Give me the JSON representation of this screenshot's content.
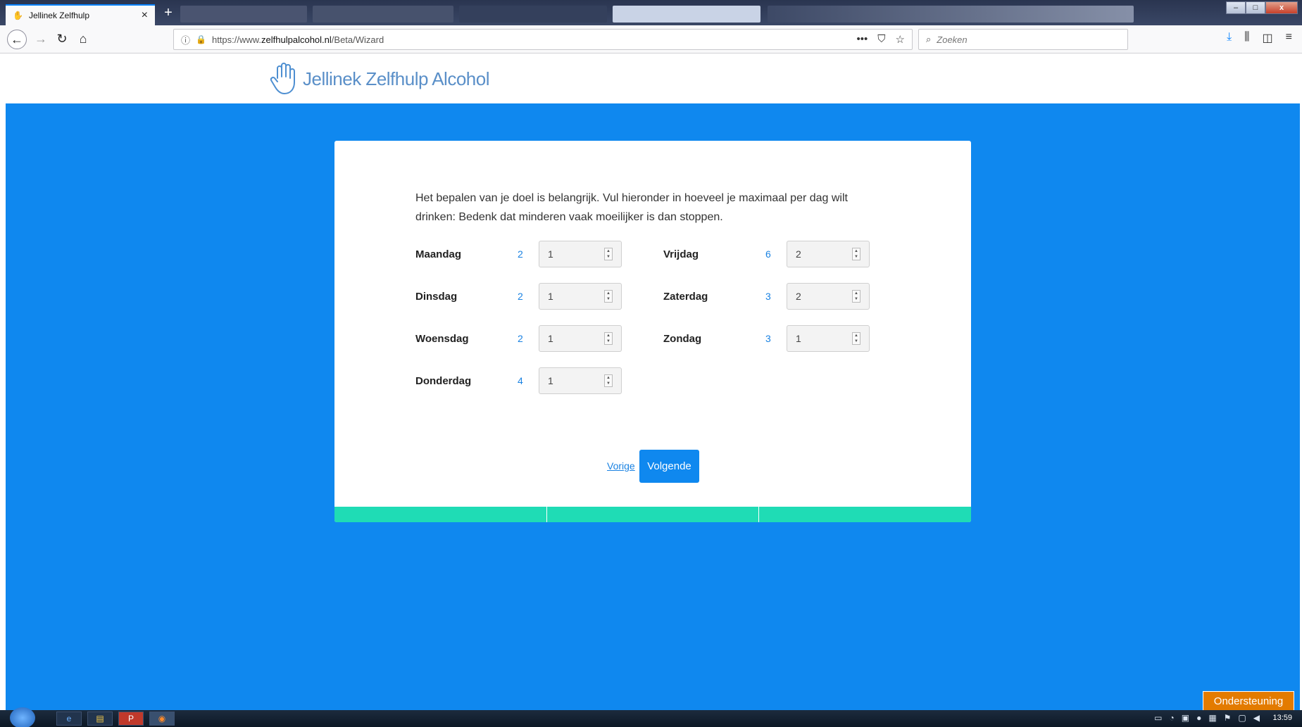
{
  "browser": {
    "tab_title": "Jellinek Zelfhulp",
    "new_tab": "+",
    "url_prefix": "https://www.",
    "url_domain": "zelfhulpalcohol.nl",
    "url_path": "/Beta/Wizard",
    "search_placeholder": "Zoeken",
    "more": "•••"
  },
  "site": {
    "logo_text": "Jellinek Zelfhulp Alcohol"
  },
  "form": {
    "intro": "Het bepalen van je doel is belangrijk. Vul hieronder in hoeveel je maximaal per dag wilt drinken: Bedenk dat minderen vaak moeilijker is dan stoppen.",
    "days": [
      {
        "label": "Maandag",
        "current": "2",
        "value": "1"
      },
      {
        "label": "Dinsdag",
        "current": "2",
        "value": "1"
      },
      {
        "label": "Woensdag",
        "current": "2",
        "value": "1"
      },
      {
        "label": "Donderdag",
        "current": "4",
        "value": "1"
      },
      {
        "label": "Vrijdag",
        "current": "6",
        "value": "2"
      },
      {
        "label": "Zaterdag",
        "current": "3",
        "value": "2"
      },
      {
        "label": "Zondag",
        "current": "3",
        "value": "1"
      }
    ],
    "prev_label": "Vorige",
    "next_label": "Volgende",
    "progress_segments": 3
  },
  "support_label": "Ondersteuning",
  "taskbar": {
    "clock": "13:59"
  },
  "colors": {
    "page_blue": "#0f88ef",
    "progress_green": "#1fdcb5",
    "support_orange": "#e37b00",
    "link_blue": "#1a82e2"
  }
}
